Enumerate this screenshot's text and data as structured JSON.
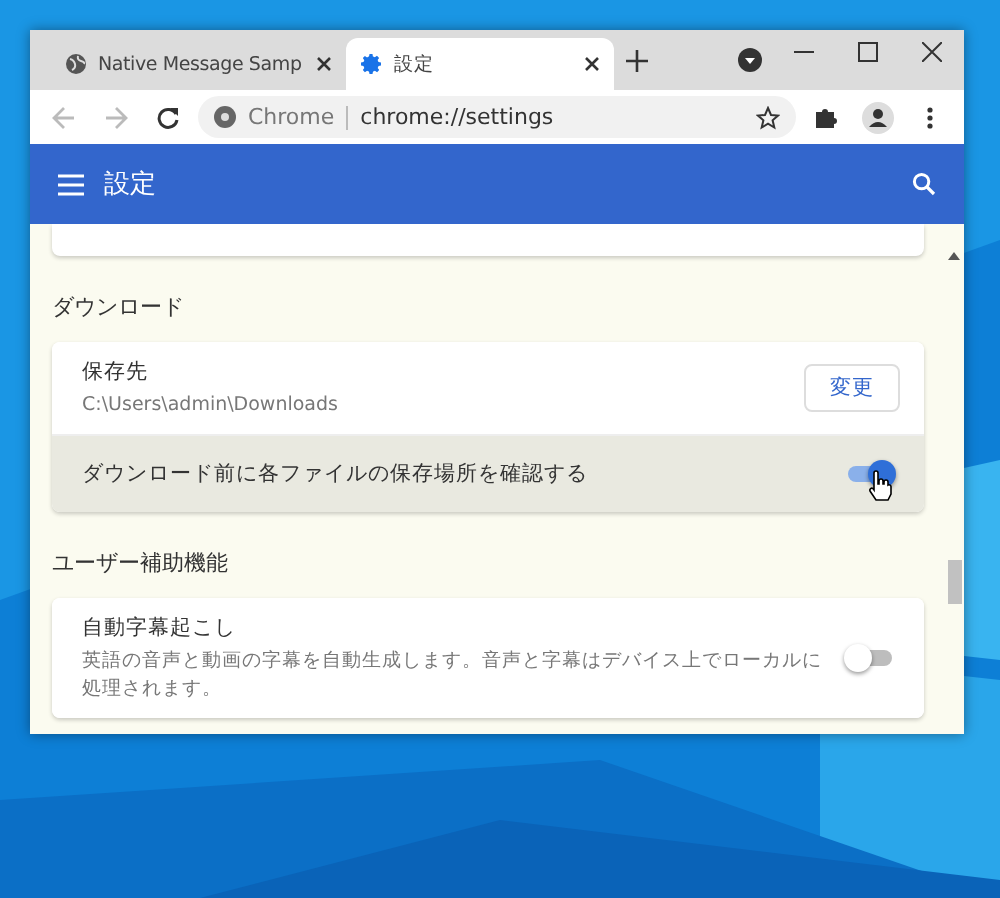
{
  "tabs": [
    {
      "title": "Native Message Samp",
      "selected": false
    },
    {
      "title": "設定",
      "selected": true
    }
  ],
  "address_bar": {
    "origin": "Chrome",
    "url": "chrome://settings"
  },
  "header": {
    "title": "設定"
  },
  "sections": [
    {
      "title": "ダウンロード",
      "rows": [
        {
          "kind": "button",
          "label": "保存先",
          "description": "C:\\Users\\admin\\Downloads",
          "button": "変更",
          "highlighted": false
        },
        {
          "kind": "toggle",
          "label": "ダウンロード前に各ファイルの保存場所を確認する",
          "on": true,
          "highlighted": true
        }
      ]
    },
    {
      "title": "ユーザー補助機能",
      "rows": [
        {
          "kind": "toggle",
          "label": "自動字幕起こし",
          "description": "英語の音声と動画の字幕を自動生成します。音声と字幕はデバイス上でローカルに処理されます。",
          "on": false,
          "highlighted": false
        }
      ]
    }
  ]
}
